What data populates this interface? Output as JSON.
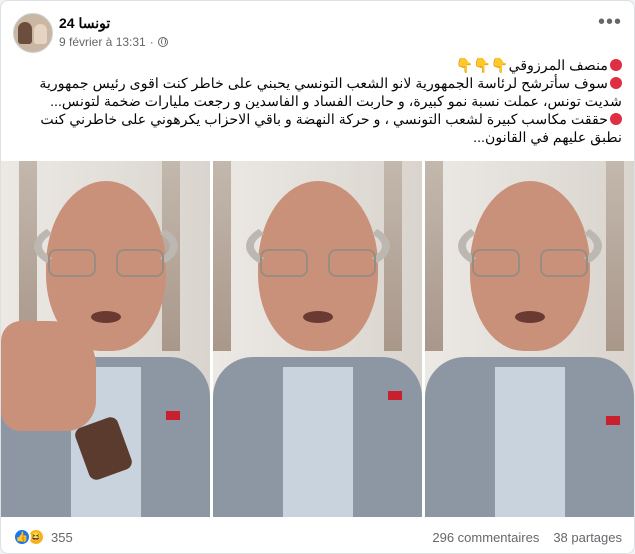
{
  "post": {
    "page_name": "تونسا 24",
    "timestamp": "9 février à 13:31",
    "separator": "·",
    "lines": [
      "منصف المرزوقي👇👇👇",
      "سوف سأترشح لرئاسة الجمهورية لانو الشعب التونسي يحبني على خاطر كنت اقوى رئيس جمهورية شديت تونس، عملت نسبة نمو كبيرة، و حاربت الفساد و الفاسدين و رجعت مليارات ضخمة لتونس...",
      "حققت مكاسب كبيرة لشعب التونسي ، و حركة النهضة و باقي الاحزاب يكرهوني على خاطرني كنت نطبق عليهم في القانون..."
    ],
    "bullet_color": "#dd2e44"
  },
  "footer": {
    "reaction_count": "355",
    "comments": "296 commentaires",
    "shares": "38 partages"
  },
  "icons": {
    "more": "more-options-icon",
    "privacy": "globe-icon",
    "like": "like-reaction-icon",
    "haha": "haha-reaction-icon"
  },
  "colors": {
    "accent": "#1877f2",
    "text": "#050505",
    "secondary": "#65676b"
  }
}
